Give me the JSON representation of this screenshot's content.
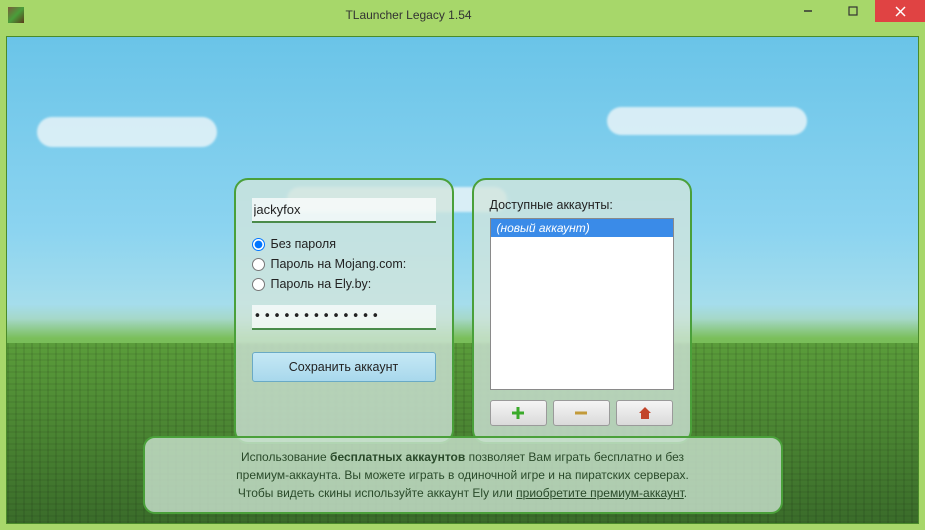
{
  "window": {
    "title": "TLauncher Legacy 1.54"
  },
  "login": {
    "username": "jackyfox",
    "options": {
      "none": "Без пароля",
      "mojang": "Пароль на Mojang.com:",
      "ely": "Пароль на Ely.by:"
    },
    "password_mask": "•••••••••••••",
    "save_label": "Сохранить аккаунт"
  },
  "accounts": {
    "title": "Доступные аккаунты:",
    "items": [
      {
        "label": "(новый аккаунт)",
        "selected": true
      }
    ]
  },
  "footer": {
    "line1_pre": "Использование ",
    "line1_bold": "бесплатных аккаунтов",
    "line1_post": " позволяет Вам играть бесплатно и без",
    "line2": "премиум-аккаунта. Вы можете играть в одиночной игре и на пиратских серверах.",
    "line3_pre": "Чтобы видеть скины используйте аккаунт Ely или ",
    "line3_link": "приобретите премиум-аккаунт",
    "line3_post": "."
  }
}
